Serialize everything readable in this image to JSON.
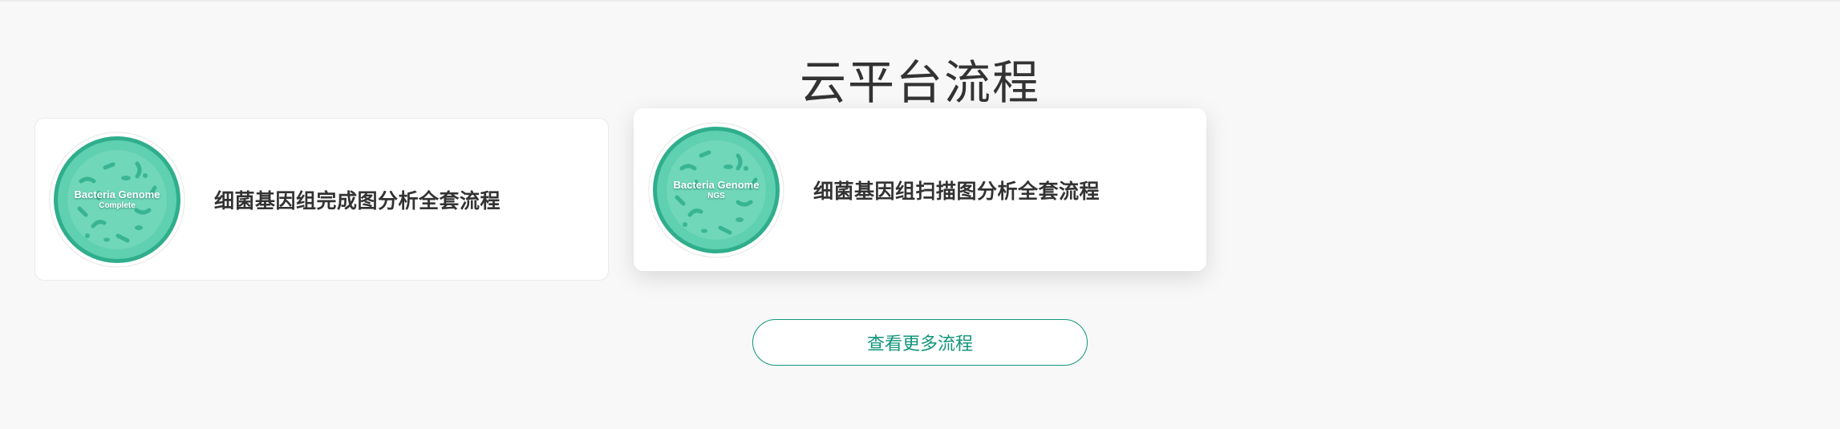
{
  "section": {
    "title": "云平台流程"
  },
  "cards": [
    {
      "title": "细菌基因组完成图分析全套流程",
      "thumb_line1": "Bacteria Genome",
      "thumb_line2": "Complete"
    },
    {
      "title": "细菌基因组扫描图分析全套流程",
      "thumb_line1": "Bacteria Genome",
      "thumb_line2": "NGS"
    }
  ],
  "more_button": {
    "label": "查看更多流程"
  },
  "colors": {
    "accent": "#12957a",
    "thumb_fill": "#5fd0b0",
    "thumb_dark": "#2fae8c",
    "background": "#f8f8f8"
  }
}
